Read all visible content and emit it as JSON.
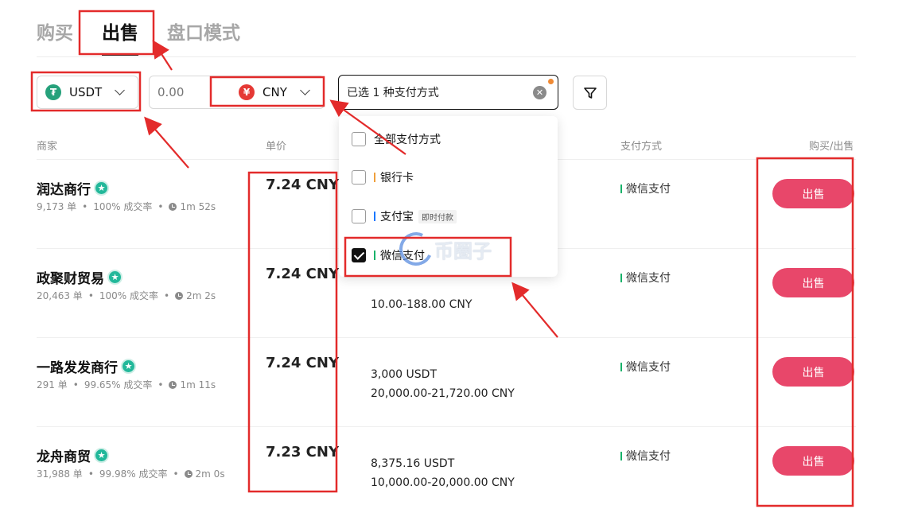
{
  "tabs": [
    {
      "label": "购买",
      "active": false
    },
    {
      "label": "出售",
      "active": true
    },
    {
      "label": "盘口模式",
      "active": false
    }
  ],
  "filters": {
    "coin": {
      "label": "USDT",
      "icon": "usdt-icon"
    },
    "amount": {
      "placeholder": "0.00",
      "value": ""
    },
    "fiat": {
      "label": "CNY",
      "icon": "yuan-icon",
      "symbol": "¥"
    },
    "payment": {
      "label": "已选 1 种支付方式"
    },
    "filter_icon": "funnel-icon"
  },
  "columns": {
    "merchant": "商家",
    "price": "单价",
    "payment": "支付方式",
    "action": "购买/出售"
  },
  "rows": [
    {
      "name": "润达商行",
      "orders": "9,173 单",
      "rate": "100% 成交率",
      "time": "1m 52s",
      "price": "7.24 CNY",
      "amount": "",
      "range": "",
      "payment": "微信支付",
      "action": "出售"
    },
    {
      "name": "政聚财贸易",
      "orders": "20,463 单",
      "rate": "100% 成交率",
      "time": "2m 2s",
      "price": "7.24 CNY",
      "amount": "",
      "range": "10.00-188.00 CNY",
      "payment": "微信支付",
      "action": "出售"
    },
    {
      "name": "一路发发商行",
      "orders": "291 单",
      "rate": "99.65% 成交率",
      "time": "1m 11s",
      "price": "7.24 CNY",
      "amount": "3,000 USDT",
      "range": "20,000.00-21,720.00 CNY",
      "payment": "微信支付",
      "action": "出售"
    },
    {
      "name": "龙舟商贸",
      "orders": "31,988 单",
      "rate": "99.98% 成交率",
      "time": "2m 0s",
      "price": "7.23 CNY",
      "amount": "8,375.16 USDT",
      "range": "10,000.00-20,000.00 CNY",
      "payment": "微信支付",
      "action": "出售"
    }
  ],
  "dropdown": {
    "options": [
      {
        "label": "全部支付方式",
        "checked": false,
        "bar_color": "",
        "sub": ""
      },
      {
        "label": "银行卡",
        "checked": false,
        "bar_color": "#f0a03c",
        "sub": ""
      },
      {
        "label": "支付宝",
        "checked": false,
        "bar_color": "#1677ff",
        "sub": "即时付款"
      },
      {
        "label": "微信支付",
        "checked": true,
        "bar_color": "#17b26a",
        "sub": ""
      }
    ]
  },
  "watermark": {
    "text": "币圈子"
  },
  "colors": {
    "accent_sell": "#e8476a",
    "annotation_red": "#e32b2b",
    "usdt": "#26a17b",
    "cny": "#e53935",
    "verified": "#22b89a"
  }
}
